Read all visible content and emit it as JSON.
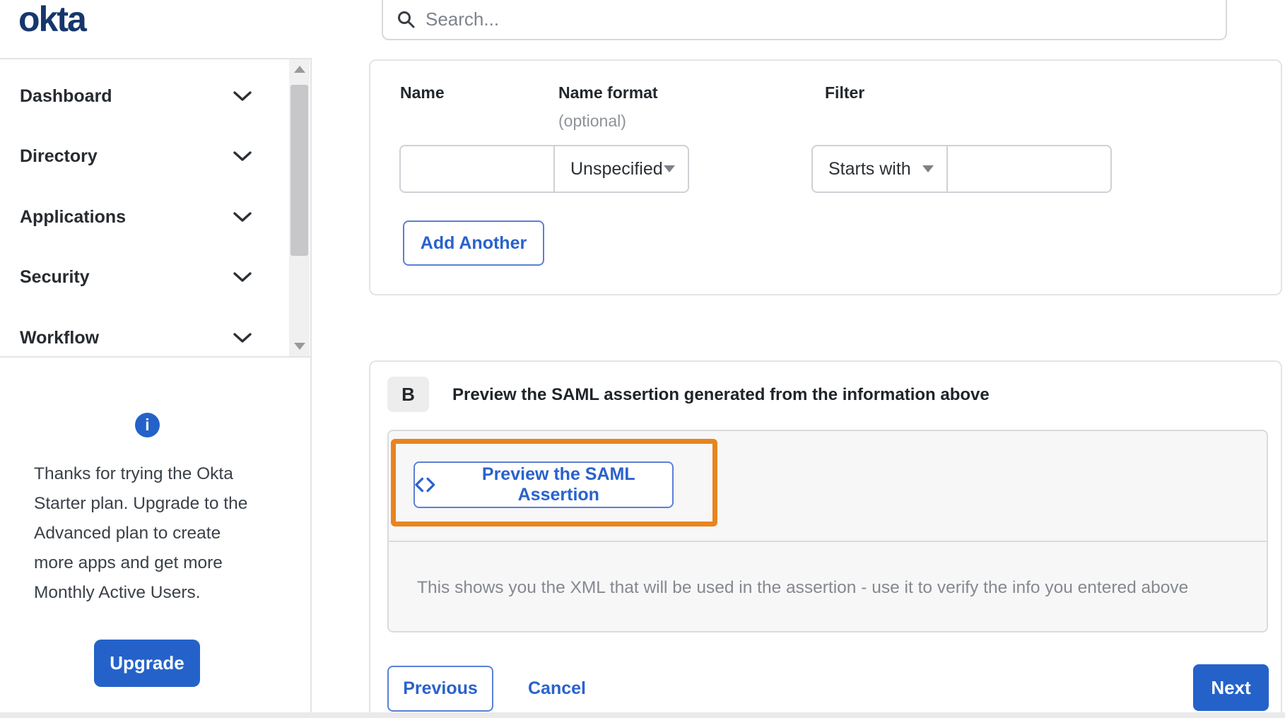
{
  "brand": {
    "logo_text": "okta"
  },
  "search": {
    "placeholder": "Search..."
  },
  "sidebar": {
    "items": [
      {
        "label": "Dashboard"
      },
      {
        "label": "Directory"
      },
      {
        "label": "Applications"
      },
      {
        "label": "Security"
      },
      {
        "label": "Workflow"
      }
    ],
    "info_icon_glyph": "i",
    "upgrade_note": "Thanks for trying the Okta Starter plan. Upgrade to the Advanced plan to create more apps and get more Monthly Active Users.",
    "upgrade_button_label": "Upgrade"
  },
  "attribute_form": {
    "columns": {
      "name_label": "Name",
      "name_format_label": "Name format",
      "name_format_sublabel": "(optional)",
      "filter_label": "Filter"
    },
    "name_value": "",
    "name_format_value": "Unspecified",
    "filter_operator_value": "Starts with",
    "filter_value": "",
    "add_another_label": "Add Another"
  },
  "preview_section": {
    "badge": "B",
    "heading": "Preview the SAML assertion generated from the information above",
    "preview_button_label": "Preview the SAML Assertion",
    "description": "This shows you the XML that will be used in the assertion - use it to verify the info you entered above"
  },
  "footer": {
    "previous_label": "Previous",
    "cancel_label": "Cancel",
    "next_label": "Next"
  },
  "colors": {
    "accent_blue": "#2462c9",
    "link_blue": "#2a62cc",
    "highlight_orange": "#e9841f",
    "okta_navy": "#16366c"
  }
}
